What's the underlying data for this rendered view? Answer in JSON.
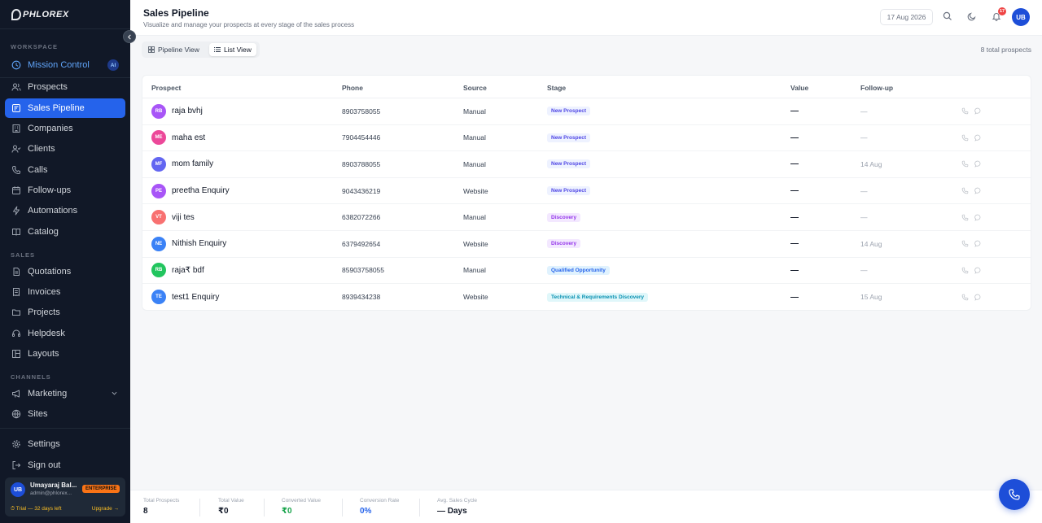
{
  "brand": {
    "logo_text": "PHLOREX"
  },
  "sidebar": {
    "sections": {
      "workspace": "WORKSPACE",
      "sales": "SALES",
      "channels": "CHANNELS"
    },
    "items": [
      {
        "key": "mission",
        "label": "Mission Control",
        "icon": "compass-icon",
        "badge": "AI"
      },
      {
        "key": "prospects",
        "label": "Prospects",
        "icon": "users-icon"
      },
      {
        "key": "pipeline",
        "label": "Sales Pipeline",
        "icon": "pipeline-icon",
        "active": true
      },
      {
        "key": "companies",
        "label": "Companies",
        "icon": "building-icon"
      },
      {
        "key": "clients",
        "label": "Clients",
        "icon": "user-check-icon"
      },
      {
        "key": "calls",
        "label": "Calls",
        "icon": "phone-icon"
      },
      {
        "key": "followups",
        "label": "Follow-ups",
        "icon": "calendar-icon"
      },
      {
        "key": "automations",
        "label": "Automations",
        "icon": "bolt-icon"
      },
      {
        "key": "catalog",
        "label": "Catalog",
        "icon": "book-icon"
      },
      {
        "key": "quotations",
        "label": "Quotations",
        "icon": "file-icon"
      },
      {
        "key": "invoices",
        "label": "Invoices",
        "icon": "receipt-icon"
      },
      {
        "key": "projects",
        "label": "Projects",
        "icon": "folder-icon"
      },
      {
        "key": "helpdesk",
        "label": "Helpdesk",
        "icon": "headset-icon"
      },
      {
        "key": "layouts",
        "label": "Layouts",
        "icon": "layout-icon"
      },
      {
        "key": "marketing",
        "label": "Marketing",
        "icon": "megaphone-icon"
      },
      {
        "key": "sites",
        "label": "Sites",
        "icon": "globe-icon"
      },
      {
        "key": "settings",
        "label": "Settings",
        "icon": "gear-icon"
      },
      {
        "key": "signout",
        "label": "Sign out",
        "icon": "logout-icon"
      }
    ],
    "user": {
      "initials": "UB",
      "name": "Umayaraj Bal...",
      "email": "admin@phlorex...",
      "plan": "ENTERPRISE",
      "trial": "⏱ Trial — 32 days left",
      "upgrade": "Upgrade →"
    }
  },
  "header": {
    "title": "Sales Pipeline",
    "subtitle": "Visualize and manage your prospects at every stage of the sales process",
    "date": "17 Aug 2026",
    "notifications_count": "17",
    "avatar_initials": "UB"
  },
  "views": {
    "pipeline": "Pipeline View",
    "list": "List View",
    "total": "8 total prospects"
  },
  "table": {
    "columns": [
      "Prospect",
      "Phone",
      "Source",
      "Stage",
      "Value",
      "Follow-up"
    ],
    "rows": [
      {
        "initials": "RB",
        "avatar_color": "#a855f7",
        "name": "raja bvhj",
        "phone": "8903758055",
        "source": "Manual",
        "stage": "New Prospect",
        "value": "—",
        "followup": "—"
      },
      {
        "initials": "ME",
        "avatar_color": "#ec4899",
        "name": "maha est",
        "phone": "7904454446",
        "source": "Manual",
        "stage": "New Prospect",
        "value": "—",
        "followup": "—"
      },
      {
        "initials": "MF",
        "avatar_color": "#6366f1",
        "name": "mom family",
        "phone": "8903788055",
        "source": "Manual",
        "stage": "New Prospect",
        "value": "—",
        "followup": "14 Aug"
      },
      {
        "initials": "PE",
        "avatar_color": "#a855f7",
        "name": "preetha Enquiry",
        "phone": "9043436219",
        "source": "Website",
        "stage": "New Prospect",
        "value": "—",
        "followup": "—"
      },
      {
        "initials": "VT",
        "avatar_color": "#f87171",
        "name": "viji tes",
        "phone": "6382072266",
        "source": "Manual",
        "stage": "Discovery",
        "value": "—",
        "followup": "—"
      },
      {
        "initials": "NE",
        "avatar_color": "#3b82f6",
        "name": "Nithish Enquiry",
        "phone": "6379492654",
        "source": "Website",
        "stage": "Discovery",
        "value": "—",
        "followup": "14 Aug"
      },
      {
        "initials": "RB",
        "avatar_color": "#22c55e",
        "name": "raja₹ bdf",
        "phone": "85903758055",
        "source": "Manual",
        "stage": "Qualified Opportunity",
        "value": "—",
        "followup": "—"
      },
      {
        "initials": "TE",
        "avatar_color": "#3b82f6",
        "name": "test1 Enquiry",
        "phone": "8939434238",
        "source": "Website",
        "stage": "Technical & Requirements Discovery",
        "value": "—",
        "followup": "15 Aug"
      }
    ]
  },
  "stage_colors": {
    "New Prospect": {
      "bg": "#eef2ff",
      "fg": "#4f46e5"
    },
    "Discovery": {
      "bg": "#f3e8ff",
      "fg": "#9333ea"
    },
    "Qualified Opportunity": {
      "bg": "#e0f2fe",
      "fg": "#2563eb"
    },
    "Technical & Requirements Discovery": {
      "bg": "#e0f7fa",
      "fg": "#0891b2"
    }
  },
  "stats": [
    {
      "label": "Total Prospects",
      "value": "8",
      "color": "#111827"
    },
    {
      "label": "Total Value",
      "value": "₹0",
      "color": "#111827"
    },
    {
      "label": "Converted Value",
      "value": "₹0",
      "color": "#16a34a"
    },
    {
      "label": "Conversion Rate",
      "value": "0%",
      "color": "#2563eb"
    },
    {
      "label": "Avg. Sales Cycle",
      "value": "— Days",
      "color": "#111827"
    }
  ]
}
